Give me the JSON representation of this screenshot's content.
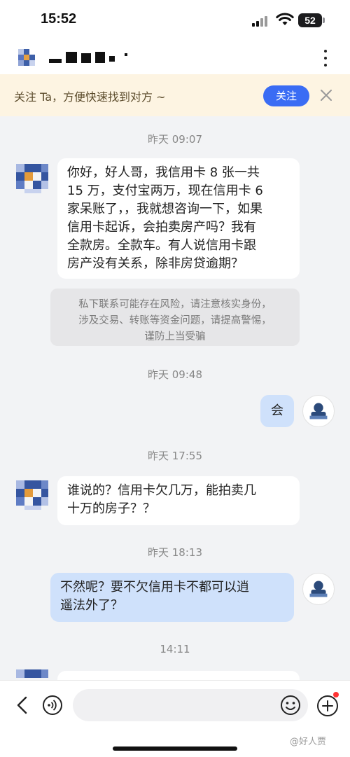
{
  "status_bar": {
    "time": "15:52",
    "battery": "52"
  },
  "header": {
    "more_icon": "more-vertical-icon"
  },
  "banner": {
    "text": "关注 Ta，方便快速找到对方 ~",
    "follow_label": "关注",
    "close_icon": "close-icon"
  },
  "chat": {
    "timestamps": [
      "昨天 09:07",
      "昨天 09:48",
      "昨天 17:55",
      "昨天 18:13",
      "14:11"
    ],
    "messages": [
      {
        "side": "in",
        "lines": [
          "你好，好人哥，我信用卡 8 张一共",
          "15 万，支付宝两万，现在信用卡 6",
          "家呆账了，，我就想咨询一下，如果",
          "信用卡起诉，会拍卖房产吗？我有",
          "全款房。全款车。有人说信用卡跟",
          "房产没有关系，除非房贷逾期？"
        ]
      },
      {
        "side": "out",
        "lines": [
          "会"
        ]
      },
      {
        "side": "in",
        "lines": [
          "谁说的？信用卡欠几万，能拍卖几",
          "十万的房子？？"
        ]
      },
      {
        "side": "out",
        "lines": [
          "不然呢？要不欠信用卡不都可以逍",
          "遥法外了？"
        ]
      }
    ],
    "warning_lines": [
      "私下联系可能存在风险，请注意核实身份，",
      "涉及交易、转账等资金问题，请提高警惕，",
      "谨防上当受骗"
    ]
  },
  "toolbar": {
    "watermark": "@好人贾"
  },
  "colors": {
    "accent": "#3a6cf4",
    "banner_bg": "#fdf4e2",
    "out_bubble": "#cfe1fb",
    "in_bubble": "#ffffff"
  }
}
